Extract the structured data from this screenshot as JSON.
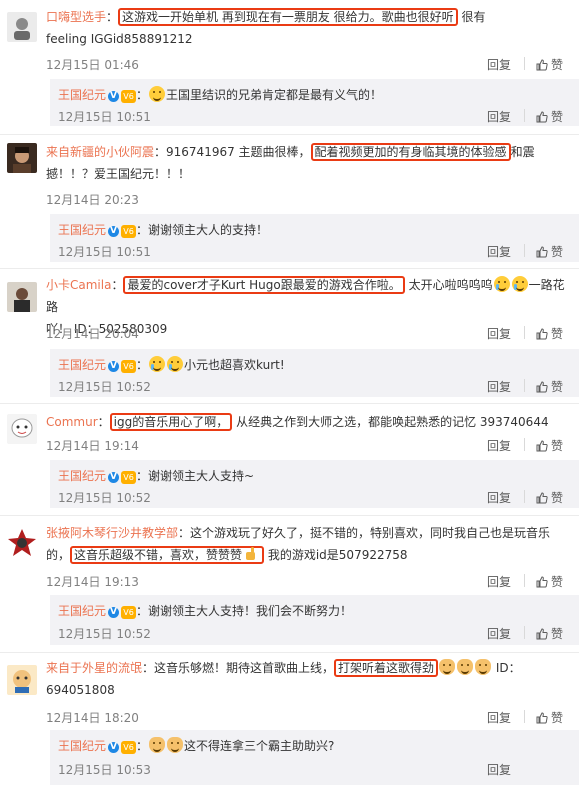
{
  "actions": {
    "reply": "回复",
    "like": "赞"
  },
  "official_name": "王国纪元",
  "badges": {
    "verified": "V",
    "level": "V6"
  },
  "comments": [
    {
      "user": "口嗨型选手",
      "pre": "",
      "highlight": "这游戏一开始单机 再到现在有一票朋友 很给力。歌曲也很好听",
      "post": "很有",
      "line2": "feeling   IGGid858891212",
      "time": "12月15日 01:46",
      "reply": {
        "text": "王国里结识的兄弟肯定都是最有义气的！",
        "time": "12月15日 10:51",
        "emoji": "smile"
      }
    },
    {
      "user": "来自新疆的小伙阿震",
      "pre": "：916741967  主题曲很棒，",
      "highlight": "配着视频更加的有身临其境的体验感",
      "post": "和震",
      "line2": "撼！！？爱王国纪元！！！",
      "time": "12月14日 20:23",
      "reply": {
        "text": "谢谢领主大人的支持！",
        "time": "12月15日 10:51",
        "emoji": "smile"
      }
    },
    {
      "user": "小卡Camila",
      "pre": "：",
      "highlight": "最爱的cover才子Kurt Hugo跟最爱的游戏合作啦。",
      "post": "太开心啦呜呜呜",
      "post2": "一路花路",
      "line2": "吖！ ID：502580309",
      "time": "12月14日 20:04",
      "reply": {
        "text": "小元也超喜欢kurt!",
        "time": "12月15日 10:52",
        "emoji": "cry2"
      }
    },
    {
      "user": "Commur",
      "pre": "：",
      "highlight": "igg的音乐用心了啊，",
      "post": "从经典之作到大师之选，都能唤起熟悉的记忆  393740644",
      "line2": "",
      "time": "12月14日 19:14",
      "reply": {
        "text": "谢谢领主大人支持~",
        "time": "12月15日 10:52",
        "emoji": "smile"
      }
    },
    {
      "user": "张掖阿木琴行沙井教学部",
      "pre": "：这个游戏玩了好久了，挺不错的，特别喜欢，同时我自己也是玩音乐",
      "highlight": "这音乐超级不错，喜欢，赞赞赞",
      "line2pre": "的，",
      "post": "  我的游戏id是507922758",
      "time": "12月14日 19:13",
      "reply": {
        "text": "谢谢领主大人支持！我们会不断努力！",
        "time": "12月15日 10:52",
        "emoji": "smile"
      }
    },
    {
      "user": "来自于外星的流氓",
      "pre": "：这音乐够燃！期待这首歌曲上线，",
      "highlight": "打架听着这歌得劲",
      "post": "ID：",
      "line2": "694051808",
      "time": "12月14日 18:20",
      "reply": {
        "text": "这不得连拿三个霸主助助兴?",
        "time": "12月15日 10:53",
        "emoji": "cat"
      }
    }
  ],
  "watermark": "X"
}
